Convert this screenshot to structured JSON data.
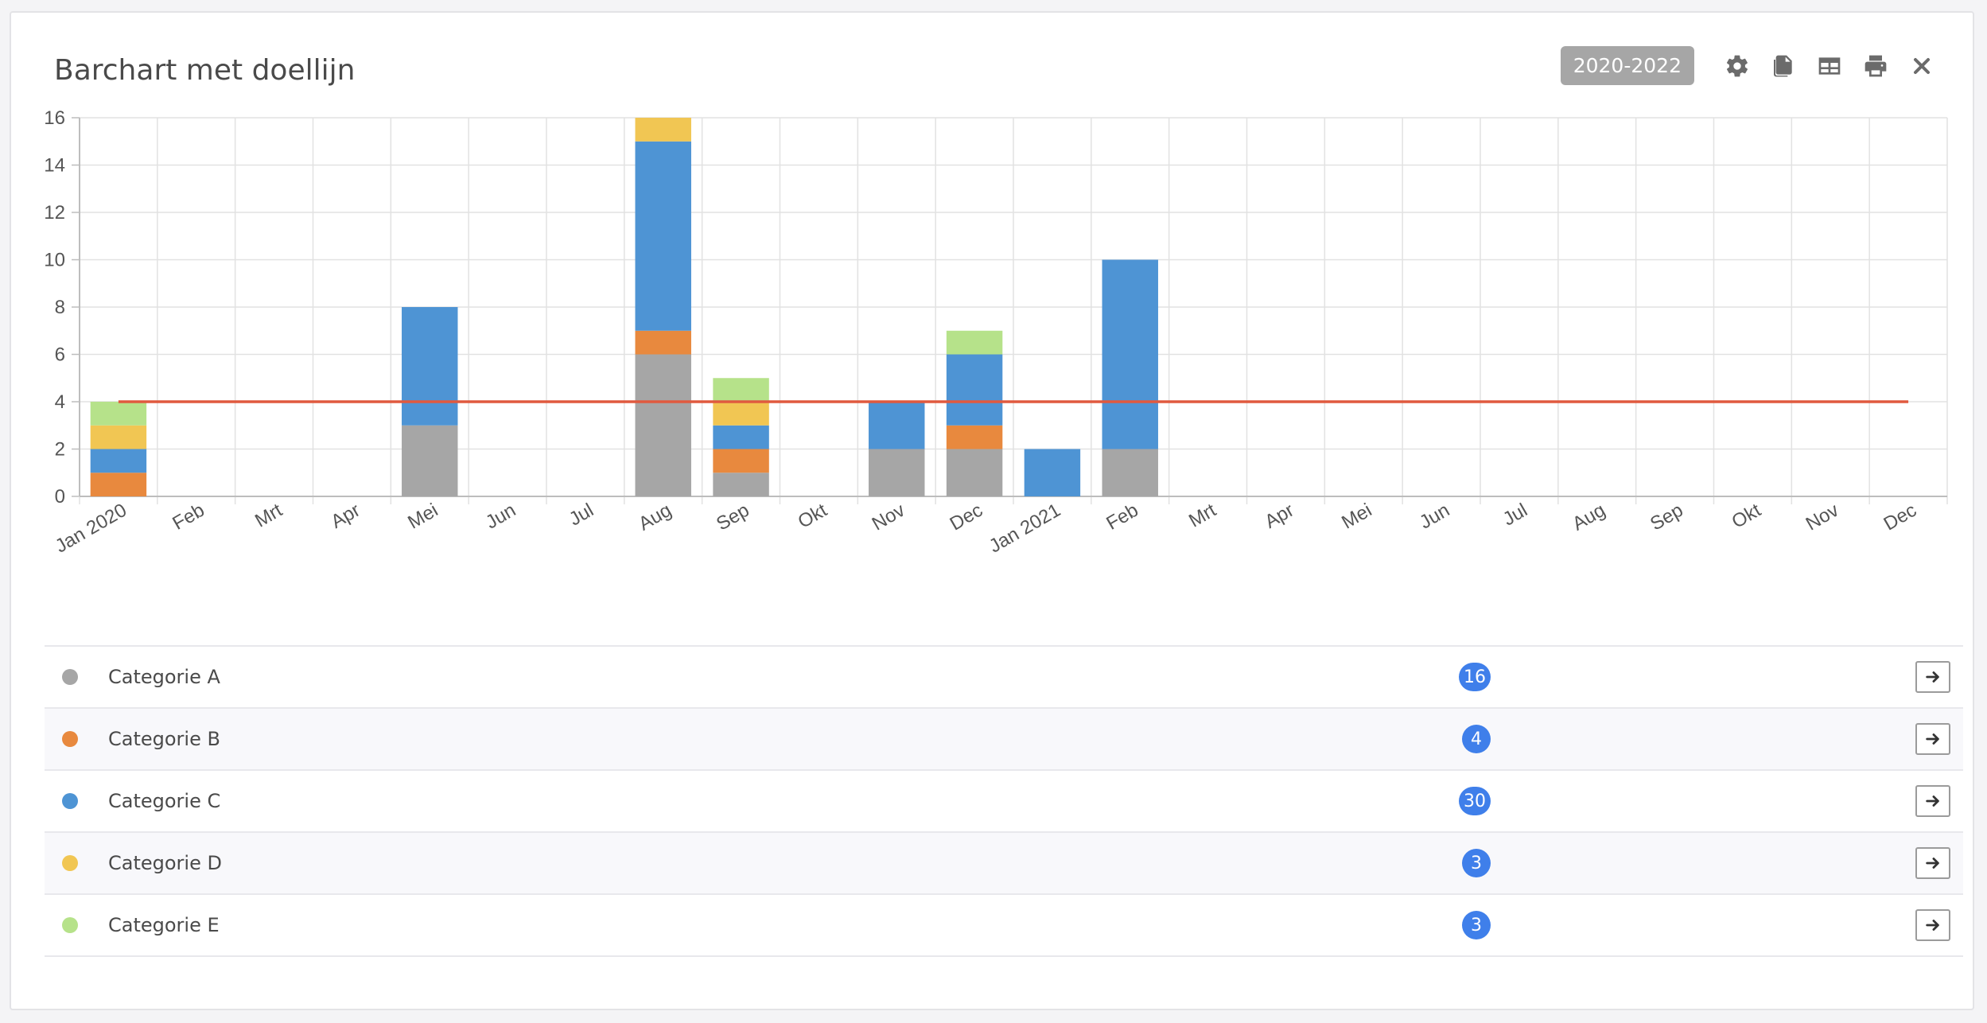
{
  "header": {
    "title": "Barchart met doellijn",
    "period_label": "2020-2022",
    "toolbar_icons": [
      "gear-icon",
      "copy-icon",
      "table-icon",
      "print-icon",
      "close-icon"
    ]
  },
  "chart_data": {
    "type": "bar",
    "stacked": true,
    "categories": [
      "Jan 2020",
      "Feb",
      "Mrt",
      "Apr",
      "Mei",
      "Jun",
      "Jul",
      "Aug",
      "Sep",
      "Okt",
      "Nov",
      "Dec",
      "Jan 2021",
      "Feb",
      "Mrt",
      "Apr",
      "Mei",
      "Jun",
      "Jul",
      "Aug",
      "Sep",
      "Okt",
      "Nov",
      "Dec"
    ],
    "series": [
      {
        "name": "Categorie A",
        "color": "#a6a6a6",
        "values": [
          0,
          0,
          0,
          0,
          3,
          0,
          0,
          6,
          1,
          0,
          2,
          2,
          0,
          2,
          0,
          0,
          0,
          0,
          0,
          0,
          0,
          0,
          0,
          0
        ]
      },
      {
        "name": "Categorie B",
        "color": "#e8893e",
        "values": [
          1,
          0,
          0,
          0,
          0,
          0,
          0,
          1,
          1,
          0,
          0,
          1,
          0,
          0,
          0,
          0,
          0,
          0,
          0,
          0,
          0,
          0,
          0,
          0
        ]
      },
      {
        "name": "Categorie C",
        "color": "#4e94d4",
        "values": [
          1,
          0,
          0,
          0,
          5,
          0,
          0,
          8,
          1,
          0,
          2,
          3,
          2,
          8,
          0,
          0,
          0,
          0,
          0,
          0,
          0,
          0,
          0,
          0
        ]
      },
      {
        "name": "Categorie D",
        "color": "#f1c653",
        "values": [
          1,
          0,
          0,
          0,
          0,
          0,
          0,
          1,
          1,
          0,
          0,
          0,
          0,
          0,
          0,
          0,
          0,
          0,
          0,
          0,
          0,
          0,
          0,
          0
        ]
      },
      {
        "name": "Categorie E",
        "color": "#b6e28a",
        "values": [
          1,
          0,
          0,
          0,
          0,
          0,
          0,
          0,
          1,
          0,
          0,
          1,
          0,
          0,
          0,
          0,
          0,
          0,
          0,
          0,
          0,
          0,
          0,
          0
        ]
      }
    ],
    "target_line": {
      "value": 4,
      "color": "#e05a3f"
    },
    "y_ticks": [
      0,
      2,
      4,
      6,
      8,
      10,
      12,
      14,
      16
    ],
    "ylim": [
      0,
      16
    ],
    "grid": true
  },
  "legend": [
    {
      "name": "Categorie A",
      "count": "16",
      "color": "#a6a6a6"
    },
    {
      "name": "Categorie B",
      "count": "4",
      "color": "#e8893e"
    },
    {
      "name": "Categorie C",
      "count": "30",
      "color": "#4e94d4"
    },
    {
      "name": "Categorie D",
      "count": "3",
      "color": "#f1c653"
    },
    {
      "name": "Categorie E",
      "count": "3",
      "color": "#b6e28a"
    }
  ]
}
